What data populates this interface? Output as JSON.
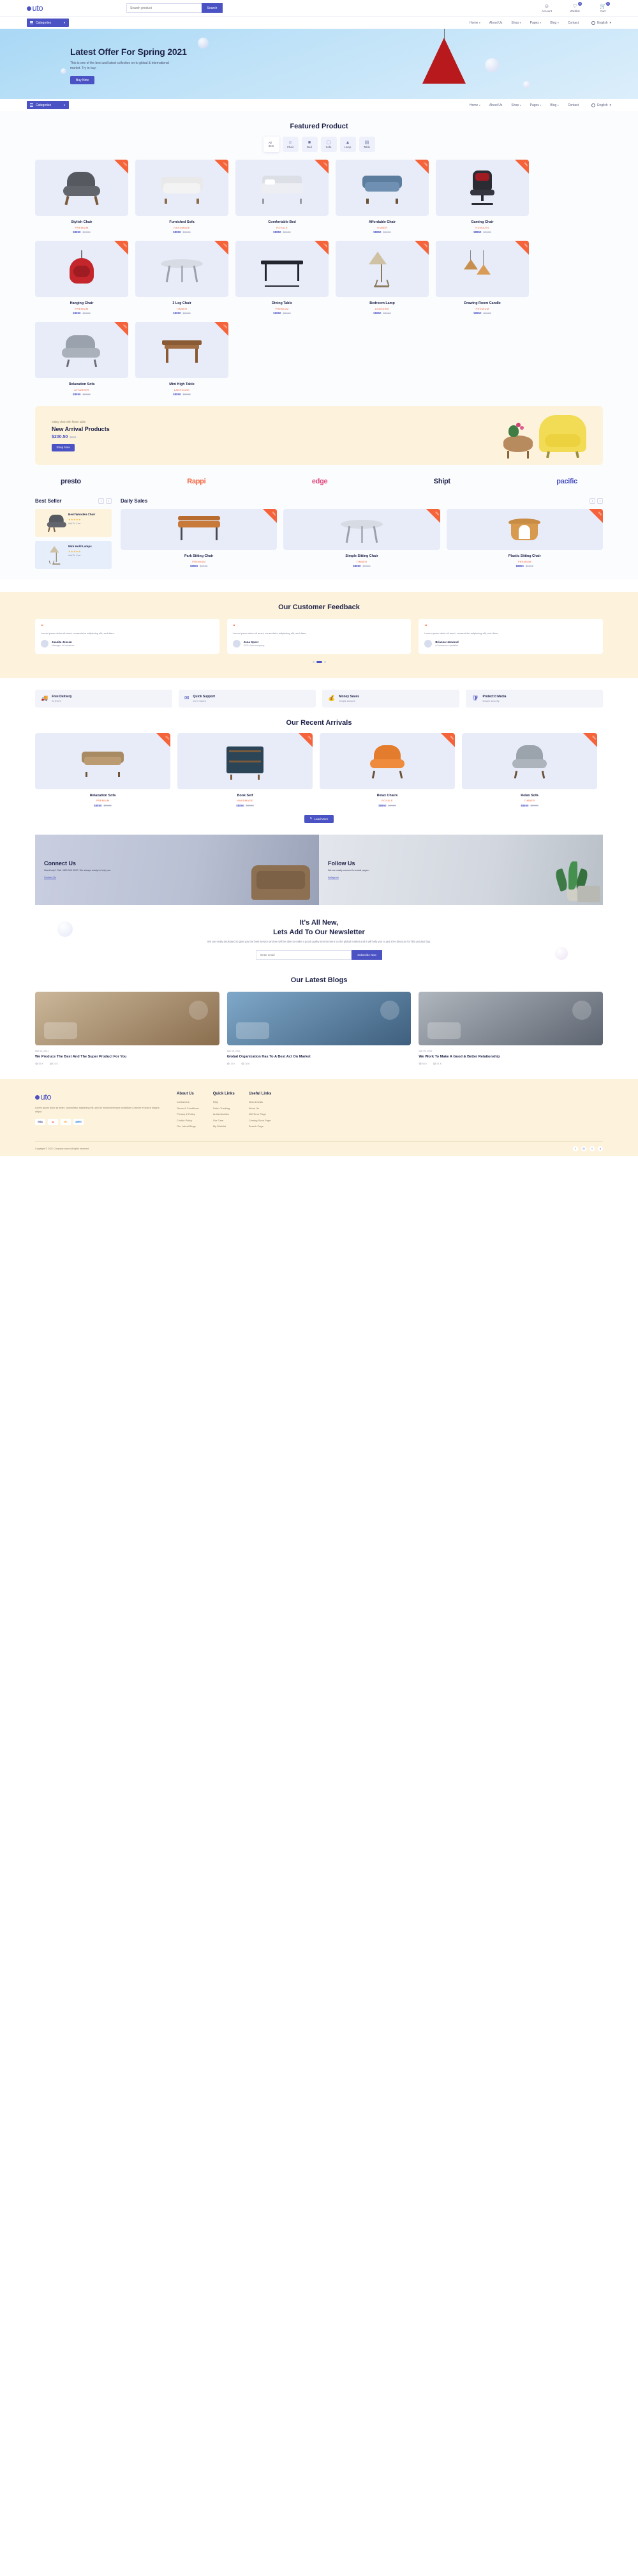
{
  "brand": {
    "name": "uto",
    "accent": "#4a52c4",
    "orange": "#f4633a",
    "cream": "#fdf3dd"
  },
  "topbar": {
    "search": {
      "placeholder": "Search product",
      "button": "Search"
    },
    "icons": [
      {
        "name": "account",
        "label": "Account",
        "glyph": "ᗡ",
        "badge": ""
      },
      {
        "name": "wishlist",
        "label": "Wishlist",
        "glyph": "♡",
        "badge": "00"
      },
      {
        "name": "cart",
        "label": "Cart",
        "glyph": "⛾",
        "badge": "00"
      }
    ]
  },
  "nav": {
    "categories_label": "Categories",
    "items": [
      "Home",
      "About Us",
      "Shop",
      "Pages",
      "Blog",
      "Contact"
    ],
    "caret_items": [
      "Home",
      "Shop",
      "Pages",
      "Blog"
    ],
    "language": "English"
  },
  "hero": {
    "title": "Latest Offer For Spring 2021",
    "subtitle": "This is one of the best and latest collection on to global & international market. Try to buy.",
    "button": "Buy Now"
  },
  "featured": {
    "title": "Featured Product",
    "filters": [
      {
        "label": "All Item",
        "icon": "",
        "active": true
      },
      {
        "label": "Chair",
        "icon": "ὋA",
        "active": false
      },
      {
        "label": "Bed",
        "icon": "⛏",
        "active": false
      },
      {
        "label": "Sofa",
        "icon": "ὬB",
        "active": false
      },
      {
        "label": "Lamp",
        "icon": "♨",
        "active": false
      },
      {
        "label": "Table",
        "icon": "⌸",
        "active": false
      }
    ],
    "products": [
      {
        "name": "Stylish Chair",
        "cat": "PREMIUM",
        "price": "$8850",
        "old": "$9990",
        "badge": "-20%",
        "art": "armchair-grey"
      },
      {
        "name": "Furnished Sofa",
        "cat": "HANDMADE",
        "price": "$8850",
        "old": "$9990",
        "badge": "-20%",
        "art": "sofa-white"
      },
      {
        "name": "Comfortable Bed",
        "cat": "ROYALE",
        "price": "$8850",
        "old": "$9990",
        "badge": "-20%",
        "art": "bed"
      },
      {
        "name": "Affordable Chair",
        "cat": "TIMBER",
        "price": "$8850",
        "old": "$9990",
        "badge": "-20%",
        "art": "sofa-blue"
      },
      {
        "name": "Gaming Chair",
        "cat": "HUNDLES",
        "price": "$8850",
        "old": "$9990",
        "badge": "-20%",
        "art": "gaming-chair"
      },
      {
        "name": "Hanging Chair",
        "cat": "PREMIUM",
        "price": "$8850",
        "old": "$9990",
        "badge": "-20%",
        "art": "hanging-chair"
      },
      {
        "name": "3 Leg Chair",
        "cat": "TIMBER",
        "price": "$8850",
        "old": "$9990",
        "badge": "-20%",
        "art": "round-table"
      },
      {
        "name": "Dining Table",
        "cat": "PREMIUM",
        "price": "$8850",
        "old": "$9990",
        "badge": "-20%",
        "art": "dining-table"
      },
      {
        "name": "Bedroom Lamp",
        "cat": "LEANDINE",
        "price": "$8850",
        "old": "$9990",
        "badge": "-20%",
        "art": "floor-lamp"
      },
      {
        "name": "Drawing Room Candle",
        "cat": "PREMIUM",
        "price": "$8850",
        "old": "$9990",
        "badge": "-20%",
        "art": "pendant-lamp"
      },
      {
        "name": "Relaxation Sofa",
        "cat": "AFTAREER",
        "price": "$8850",
        "old": "$9990",
        "badge": "-20%",
        "art": "relax-sofa"
      },
      {
        "name": "Mini High Table",
        "cat": "LADHOUSE",
        "price": "$8850",
        "old": "$9990",
        "badge": "-20%",
        "art": "wood-table"
      }
    ]
  },
  "arrival": {
    "eyebrow": "Sitting chair with flower table",
    "title": "New Arrival Products",
    "price": "$200.50",
    "old": "$990",
    "button": "Shop Now"
  },
  "brands": [
    {
      "name": "presto",
      "color": "#22264c"
    },
    {
      "name": "Rappi",
      "color": "#f4633a"
    },
    {
      "name": "edge",
      "color": "#e0457b"
    },
    {
      "name": "Shipt",
      "color": "#1d2147"
    },
    {
      "name": "pacific",
      "color": "#4a52c4"
    }
  ],
  "bestseller": {
    "title": "Best Seller",
    "items": [
      {
        "name": "Best Wooden Chair",
        "stars": "★★★★★",
        "atc": "Add To Cart",
        "art": "armchair-grey"
      },
      {
        "name": "Mini Hold Lamps",
        "stars": "★★★★★",
        "atc": "Add To Cart",
        "art": "floor-lamp"
      }
    ]
  },
  "dailysales": {
    "title": "Daily Sales",
    "products": [
      {
        "name": "Park Sitting Chair",
        "cat": "PREMIUM",
        "price": "$8850",
        "old": "$9990",
        "badge": "-20%",
        "art": "bench"
      },
      {
        "name": "Simple Sitting Chair",
        "cat": "TIMBER",
        "price": "$8850",
        "old": "$9990",
        "badge": "-20%",
        "art": "round-table"
      },
      {
        "name": "Plastic Sitting Chair",
        "cat": "PREMIUM",
        "price": "$8850",
        "old": "$9990",
        "badge": "-20%",
        "art": "stool"
      }
    ]
  },
  "feedback": {
    "title": "Our Customer Feedback",
    "cards": [
      {
        "text": "Lorem ipsum dolor sit amet, consectetur adipiscing elit, sed diam.",
        "name": "Juanita Jensen",
        "role": "Manager, eCommerce"
      },
      {
        "text": "Lorem ipsum dolor sit amet, consectetur adipiscing elit, sed diam.",
        "name": "Jona Speer",
        "role": "CEO, Nola company"
      },
      {
        "text": "Lorem ipsum dolor sit amet, consectetur adipiscing elit, sed diam.",
        "name": "Brianna Harwood",
        "role": "eCommerce specialist"
      }
    ]
  },
  "features": [
    {
      "icon": "ὩA",
      "title": "Free Delivery",
      "sub": "At Event"
    },
    {
      "icon": "ὊC",
      "title": "Quick Support",
      "sub": "24 hr Saves"
    },
    {
      "icon": "Ὃ0",
      "title": "Money Saves",
      "sub": "Simple amount"
    },
    {
      "icon": "Ὦ1",
      "title": "Protect'd Media",
      "sub": "Ensure security"
    }
  ],
  "recent": {
    "title": "Our Recent Arrivals",
    "products": [
      {
        "name": "Relaxation Sofa",
        "cat": "PREMIUM",
        "price": "$8850",
        "old": "$9990",
        "badge": "-20%",
        "art": "long-sofa"
      },
      {
        "name": "Book Self",
        "cat": "HANDMADE",
        "price": "$8850",
        "old": "$9990",
        "badge": "-20%",
        "art": "bookshelf"
      },
      {
        "name": "Relax Chairs",
        "cat": "ROYALE",
        "price": "$8850",
        "old": "$9990",
        "badge": "-20%",
        "art": "orange-chair"
      },
      {
        "name": "Relax Sofa",
        "cat": "TIMBER",
        "price": "$8850",
        "old": "$9990",
        "badge": "-20%",
        "art": "grey-chair"
      }
    ],
    "loadmore": "Load More"
  },
  "connect": {
    "left": {
      "title": "Connect Us",
      "text": "Need help? Call +880 000 0000. We always ready to help you.",
      "link": "Contact Us"
    },
    "right": {
      "title": "Follow Us",
      "text": "We are easily connect to social pages.",
      "link": "Instagram"
    }
  },
  "newsletter": {
    "line1": "It's All New,",
    "line2": "Lets Add To Our Newsletter",
    "text": "We are really dedicated to give you the best service and we will be able to make a good quality environment on the global market and it will help you to get 20% discount for first product buy.",
    "placeholder": "Enter email",
    "button": "Subscribe Now"
  },
  "blogs": {
    "title": "Our Latest Blogs",
    "posts": [
      {
        "date": "Mar 03, 2021",
        "title": "We Produce The Best And The Super Product For You",
        "views": "53 K",
        "comments": "23 K",
        "art": "blog-room"
      },
      {
        "date": "Mar 05, 2021",
        "title": "Global Organization Has To A Best Act On Market",
        "views": "72 K",
        "comments": "18 K",
        "art": "blog-people"
      },
      {
        "date": "Mar 09, 2021",
        "title": "We Work To Make A Good & Better Relationship",
        "views": "64 K",
        "comments": "41 K",
        "art": "blog-office"
      }
    ]
  },
  "footer": {
    "about_text": "Lorem ipsum dolor sit amet, consectetur adipiscing elit, sed do eiusmod tempor incididunt ut labore et dolore magna aliqua.",
    "cards": [
      "VISA",
      "●●",
      "MC",
      "AMEX"
    ],
    "columns": [
      {
        "heading": "About Us",
        "links": [
          "Contact Us",
          "Terms & Conditions",
          "Privacy & Policy",
          "Cookie Policy",
          "Our Latest Blogs"
        ]
      },
      {
        "heading": "Quick Links",
        "links": [
          "FAQ",
          "Order Tracking",
          "Authentication",
          "Our Care",
          "My Wishlist"
        ]
      },
      {
        "heading": "Useful Links",
        "links": [
          "New Arrivals",
          "About Us",
          "400 Error Page",
          "Coming Soon Page",
          "Search Page"
        ]
      }
    ],
    "copyright": "Copyright © 2021 Company name All rights reserved.",
    "social": [
      "f",
      "◎",
      "t",
      "p"
    ]
  }
}
